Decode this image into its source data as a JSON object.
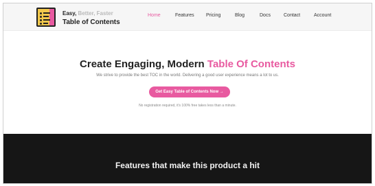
{
  "brand": {
    "tagline_part1": "Easy,",
    "tagline_part2": "Better, Faster",
    "name": "Table of Contents",
    "logo_icon": "toc-document-icon"
  },
  "nav": {
    "items": [
      "Home",
      "Features",
      "Pricing",
      "Blog",
      "Docs",
      "Contact",
      "Account"
    ],
    "active": "Home"
  },
  "hero": {
    "title_main": "Create Engaging, Modern ",
    "title_accent": "Table Of Contents",
    "subtitle": "We strive to provide the best TOC in the world. Delivering a good user experience means a lot to us.",
    "cta_label": "Get Easy Table of Contents Now",
    "cta_arrow": "→",
    "note": "No registration required, it's 100% free takes less than a minute."
  },
  "features": {
    "heading": "Features that make this product a hit"
  },
  "colors": {
    "accent": "#e85aa0",
    "dark_section": "#161616",
    "header_bg": "#f6f6f6"
  }
}
